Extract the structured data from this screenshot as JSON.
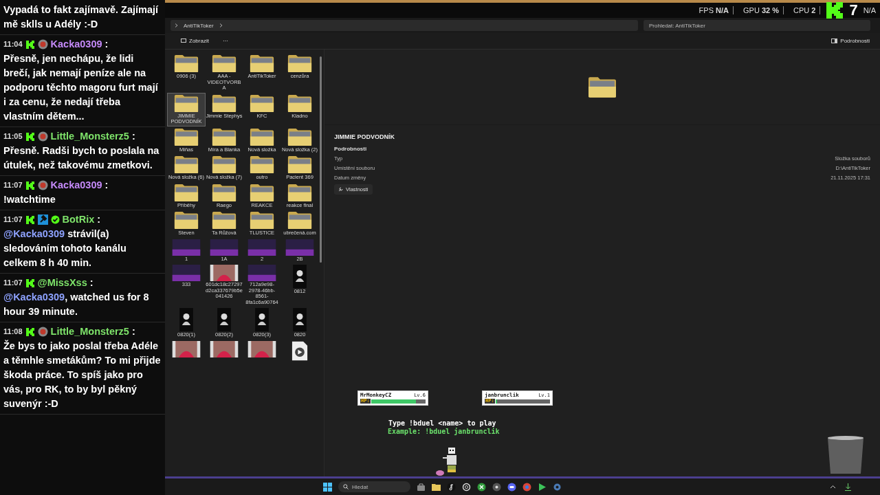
{
  "chat": {
    "messages": [
      {
        "kind": "continuation",
        "parts": [
          {
            "text": "Vypadá to fakt zajímavě. Zajímají mě sklls u Adély :-D"
          }
        ]
      },
      {
        "kind": "subscriber",
        "time": "11:04",
        "user": "Kacka0309",
        "separator": ":",
        "color": "#c58af9",
        "parts": [
          {
            "text": "Přesně, jen nechápu, že lidi brečí, jak nemají peníze ale na podporu těchto magoru furt mají i za cenu, že nedají třeba vlastním dětem..."
          }
        ]
      },
      {
        "kind": "subscriber",
        "time": "11:05",
        "user": "Little_Monsterz5",
        "separator": ":",
        "color": "#7ee36a",
        "parts": [
          {
            "text": "Přesně. Radši bych to poslala na útulek, než takovému zmetkovi."
          }
        ]
      },
      {
        "kind": "subscriber",
        "time": "11:07",
        "user": "Kacka0309",
        "separator": ":",
        "color": "#c58af9",
        "parts": [
          {
            "text": "!watchtime"
          }
        ]
      },
      {
        "kind": "bot",
        "time": "11:07",
        "user": "BotRix",
        "separator": ":",
        "color": "#7ee36a",
        "parts": [
          {
            "text": "@Kacka0309",
            "kind": "mention"
          },
          {
            "text": " strávil(a) sledováním tohoto kanálu celkem 8 h 40 min."
          }
        ]
      },
      {
        "kind": "member",
        "time": "11:07",
        "user": "@MissXss",
        "separator": ":",
        "color": "#7ee36a",
        "parts": [
          {
            "text": "@Kacka0309",
            "kind": "mention"
          },
          {
            "text": ", watched us for 8 hour 39 minute."
          }
        ]
      },
      {
        "kind": "subscriber",
        "time": "11:08",
        "user": "Little_Monsterz5",
        "separator": ":",
        "color": "#7ee36a",
        "parts": [
          {
            "text": "Že bys to jako poslal třeba Adéle a těmhle smetákům? To mi přijde škoda práce. To spíš jako pro vás, pro RK, to by byl pěkný suvenýr :-D"
          }
        ]
      }
    ]
  },
  "stats": [
    {
      "label": "FPS",
      "value": "N/A"
    },
    {
      "label": "GPU",
      "value": "32 %"
    },
    {
      "label": "CPU",
      "value": "2"
    }
  ],
  "stream_badge": {
    "count": "7",
    "trailing_value": "N/A"
  },
  "explorer": {
    "breadcrumb": [
      "AntiTikToker"
    ],
    "search": {
      "placeholder": "Prohledat: AntiTikToker"
    },
    "toolbar": {
      "view": "Zobrazit",
      "more": "⋯",
      "details": "Podrobnosti"
    },
    "files": [
      {
        "name": "0906 (3)",
        "kind": "folder",
        "selected": false
      },
      {
        "name": "AAA - VIDEOTVORBA",
        "kind": "folder",
        "selected": false
      },
      {
        "name": "AntiTikToker",
        "kind": "folder",
        "selected": false
      },
      {
        "name": "cenzůra",
        "kind": "folder",
        "selected": false
      },
      {
        "name": "JIMMIE PODVODNÍK",
        "kind": "folder",
        "selected": true
      },
      {
        "name": "Jimmie Stephys",
        "kind": "folder",
        "selected": false
      },
      {
        "name": "KFC",
        "kind": "folder",
        "selected": false
      },
      {
        "name": "Kladno",
        "kind": "folder",
        "selected": false
      },
      {
        "name": "Miňas",
        "kind": "folder",
        "selected": false
      },
      {
        "name": "Míra a Blanka",
        "kind": "folder",
        "selected": false
      },
      {
        "name": "Nová složka",
        "kind": "folder",
        "selected": false
      },
      {
        "name": "Nová složka (2)",
        "kind": "folder",
        "selected": false
      },
      {
        "name": "Nová složka (6)",
        "kind": "folder",
        "selected": false
      },
      {
        "name": "Nová složka (7)",
        "kind": "folder",
        "selected": false
      },
      {
        "name": "outro",
        "kind": "folder",
        "selected": false
      },
      {
        "name": "Pacient 369",
        "kind": "folder",
        "selected": false
      },
      {
        "name": "Příběhy",
        "kind": "folder",
        "selected": false
      },
      {
        "name": "Raego",
        "kind": "folder",
        "selected": false
      },
      {
        "name": "REAKCE",
        "kind": "folder",
        "selected": false
      },
      {
        "name": "reakce final",
        "kind": "folder",
        "selected": false
      },
      {
        "name": "Steven",
        "kind": "folder",
        "selected": false
      },
      {
        "name": "Ta Růžová",
        "kind": "folder",
        "selected": false
      },
      {
        "name": "TLUSTICE",
        "kind": "folder",
        "selected": false
      },
      {
        "name": "ubrečená.com",
        "kind": "folder",
        "selected": false
      },
      {
        "name": "1",
        "kind": "image",
        "selected": false
      },
      {
        "name": "1A",
        "kind": "image",
        "selected": false
      },
      {
        "name": "2",
        "kind": "image",
        "selected": false
      },
      {
        "name": "2B",
        "kind": "image",
        "selected": false
      },
      {
        "name": "333",
        "kind": "image",
        "selected": false
      },
      {
        "name": "601dc18c27297d2ca337679b5e041426",
        "kind": "video",
        "selected": false
      },
      {
        "name": "712a9e98-2978-46bb-8561-8fa1c6a90764",
        "kind": "image",
        "selected": false
      },
      {
        "name": "0812",
        "kind": "portrait",
        "selected": false
      },
      {
        "name": "0820(1)",
        "kind": "portrait",
        "selected": false
      },
      {
        "name": "0820(2)",
        "kind": "portrait",
        "selected": false
      },
      {
        "name": "0820(3)",
        "kind": "portrait",
        "selected": false
      },
      {
        "name": "0820",
        "kind": "portrait",
        "selected": false
      },
      {
        "kind": "video",
        "selected": false
      },
      {
        "kind": "video",
        "selected": false
      },
      {
        "kind": "video",
        "selected": false
      },
      {
        "kind": "media_file",
        "selected": false
      }
    ],
    "details": {
      "title": "JIMMIE PODVODNÍK",
      "section": "Podrobnosti",
      "rows": [
        {
          "label": "Typ",
          "value": "Složka souborů"
        },
        {
          "label": "Umístění souboru",
          "value": "D:\\AntiTikToker"
        },
        {
          "label": "Datum změny",
          "value": "21.11.2025 17:31"
        }
      ],
      "button": "Vlastnosti"
    }
  },
  "game": {
    "players": [
      {
        "name": "MrMonkeyCZ",
        "rank": "Lv.6",
        "hp_label": "HP:",
        "level": 0.82
      },
      {
        "name": "janbrunclik",
        "rank": "Lv.1",
        "hp_label": "HP:",
        "level": 0
      }
    ],
    "instruction": "Type !bduel <name> to play",
    "example": "Example: !bduel janbrunclik"
  },
  "taskbar": {
    "search": {
      "placeholder": "Hledat"
    }
  }
}
